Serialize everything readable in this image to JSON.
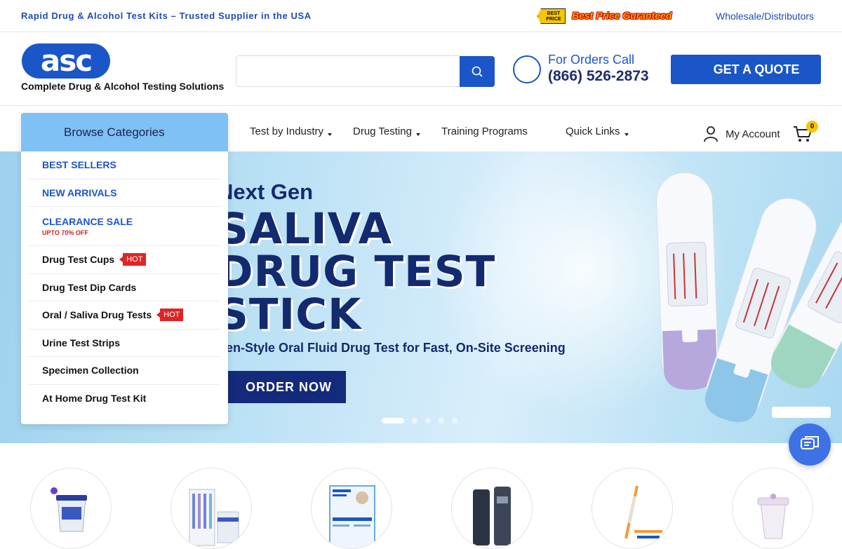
{
  "topbar": {
    "tagline": "Rapid Drug & Alcohol Test Kits – Trusted Supplier in the USA",
    "best_badge": "BEST PRICE",
    "best_price": "Best Price Guranteed",
    "wholesale": "Wholesale/Distributors"
  },
  "header": {
    "logo_text": "asc",
    "logo_tagline": "Complete Drug & Alcohol Testing Solutions",
    "search_placeholder": "",
    "orders_call": "For Orders Call",
    "phone": "(866) 526-2873",
    "quote_button": "GET A QUOTE"
  },
  "nav": {
    "browse": "Browse Categories",
    "items": [
      {
        "label": "Test by Industry",
        "dropdown": true
      },
      {
        "label": "Drug Testing",
        "dropdown": true
      },
      {
        "label": "Training Programs",
        "dropdown": false
      },
      {
        "label": "Quick Links",
        "dropdown": true
      }
    ],
    "account": "My Account",
    "cart_count": "0"
  },
  "categories": [
    {
      "label": "BEST SELLERS",
      "style": "blue"
    },
    {
      "label": "NEW ARRIVALS",
      "style": "blue"
    },
    {
      "label": "CLEARANCE SALE",
      "style": "blue",
      "sub": "UPTO 70% OFF"
    },
    {
      "label": "Drug Test Cups",
      "badge": "HOT"
    },
    {
      "label": "Drug Test Dip Cards"
    },
    {
      "label": "Oral / Saliva Drug Tests",
      "badge": "HOT"
    },
    {
      "label": "Urine Test Strips"
    },
    {
      "label": "Specimen Collection"
    },
    {
      "label": "At Home Drug Test Kit"
    }
  ],
  "hero": {
    "subtitle": "Next Gen",
    "lines": [
      "SALIVA",
      "DRUG TEST",
      "STICK"
    ],
    "description": "Pen-Style Oral Fluid Drug Test for Fast, On-Site Screening",
    "cta": "ORDER NOW",
    "slides": 5,
    "active_slide": 1
  },
  "colors": {
    "brand": "#1a56c8",
    "navy": "#142a6e",
    "hot": "#e02424",
    "category_header": "#7fc0f5"
  }
}
